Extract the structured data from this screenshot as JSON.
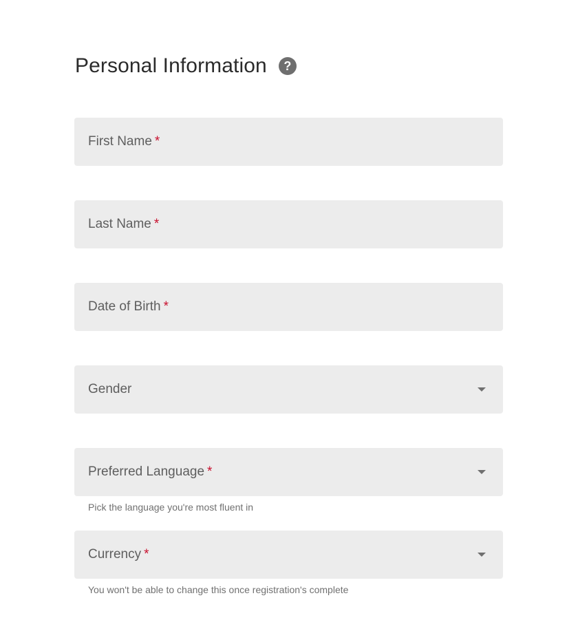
{
  "header": {
    "title": "Personal Information",
    "help_glyph": "?",
    "help_icon": "help-circle-icon"
  },
  "form": {
    "first_name": {
      "label": "First Name",
      "required_mark": "*"
    },
    "last_name": {
      "label": "Last Name",
      "required_mark": "*"
    },
    "date_of_birth": {
      "label": "Date of Birth",
      "required_mark": "*"
    },
    "gender": {
      "label": "Gender",
      "icon": "chevron-down-icon"
    },
    "preferred_language": {
      "label": "Preferred Language",
      "required_mark": "*",
      "helper": "Pick the language you're most fluent in",
      "icon": "chevron-down-icon"
    },
    "currency": {
      "label": "Currency",
      "required_mark": "*",
      "helper": "You won't be able to change this once registration's complete",
      "icon": "chevron-down-icon"
    }
  },
  "colors": {
    "field_background": "#ececec",
    "required": "#c8102e",
    "label": "#5e5e5e",
    "helper": "#707070",
    "title": "#2b2b2b",
    "icon": "#6f6f6f"
  }
}
